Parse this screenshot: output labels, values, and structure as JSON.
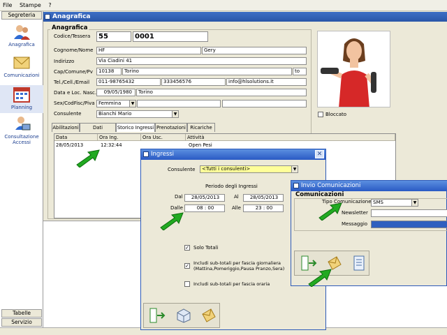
{
  "menu": [
    "File",
    "Stampe",
    "?"
  ],
  "sidebar": {
    "header_top": "Segreteria",
    "items": [
      {
        "label": "Anagrafica"
      },
      {
        "label": "Comunicazioni"
      },
      {
        "label": "Planning"
      },
      {
        "label": "Consultazione Accessi"
      }
    ],
    "bottom_1": "Tabelle",
    "bottom_2": "Servizio"
  },
  "main": {
    "title": "Anagrafica",
    "section": "Anagrafica",
    "labels": {
      "codice": "Codice/Tessera",
      "cognome": "Cognome/Nome",
      "indirizzo": "Indirizzo",
      "cap": "Cap/Comune/Pv",
      "tel": "Tel./Cell./Email",
      "nascita": "Data e Loc. Nasc.",
      "sex": "Sex/CodFisc/Piva",
      "consulente": "Consulente"
    },
    "values": {
      "codice1": "55",
      "codice2": "0001",
      "cognome": "HF",
      "nome": "Gery",
      "indirizzo": "Via Ciadini 41",
      "cap": "10138",
      "comune": "Torino",
      "pv": "to",
      "tel": "011-98765432",
      "cell": "333456576",
      "email": "info@hlsolutions.it",
      "data_nasc": "09/05/1980",
      "loc_nasc": "Torino",
      "sex": "Femmina",
      "consulente": "Bianchi Mario"
    },
    "bloccato": "Bloccato",
    "tabs": [
      "Abilitazioni",
      "Dati Aggiuntivi",
      "Storico Ingressi",
      "Prenotazioni",
      "Ricariche"
    ],
    "grid": {
      "headers": [
        "Data",
        "Ora Ing.",
        "Ora Usc.",
        "Attività"
      ],
      "row": [
        "28/05/2013",
        "12:32:44",
        "",
        "Open Pesi"
      ]
    }
  },
  "ingressi": {
    "title": "Ingressi",
    "consulente_label": "Consulente",
    "consulente_value": "<Tutti i consulenti>",
    "periodo": "Periodo degli Ingressi",
    "dal_label": "Dal",
    "dal_value": "28/05/2013",
    "al_label": "Al",
    "al_value": "28/05/2013",
    "dalle_label": "Dalle",
    "dalle_value": "08 : 00",
    "alle_label": "Alle",
    "alle_value": "23 : 00",
    "solo_totali": "Solo Totali",
    "subtot_giornaliera": "Includi sub-totali per fascia giornaliera",
    "subtot_giornaliera_2": "(Mattina,Pomeriggio,Pausa Pranzo,Sera)",
    "subtot_oraria": "Includi sub-totali per fascia oraria"
  },
  "invio": {
    "title": "Invio Comunicazioni",
    "section": "Comunicazioni",
    "tipo_label": "Tipo Comunicazione",
    "tipo_value": "SMS",
    "newsletter_label": "Newsletter",
    "messaggio_label": "Messaggio"
  },
  "colors": {
    "title_bar": "#2a56a8",
    "dialog_title": "#3a6fd6",
    "consulente_highlight": "#ffff99",
    "message_bar": "#2f5fbf",
    "arrow": "#22aa22"
  }
}
